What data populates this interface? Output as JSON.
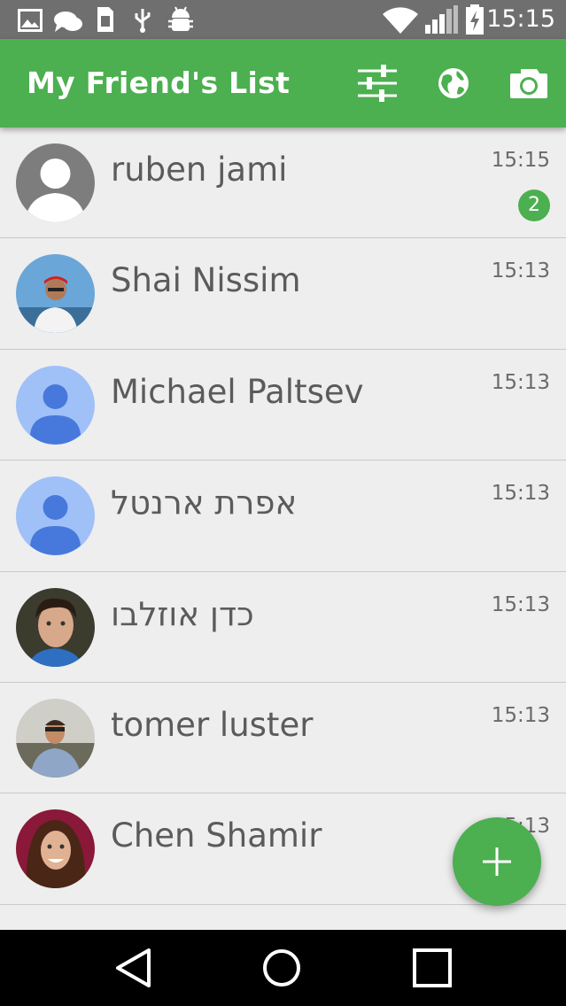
{
  "status_bar": {
    "time": "15:15",
    "icons": [
      "image-icon",
      "chat-icon",
      "sim-icon",
      "usb-icon",
      "android-debug-icon",
      "wifi-icon",
      "signal-icon",
      "battery-charging-icon"
    ]
  },
  "app_bar": {
    "title": "My Friend's List",
    "actions": [
      "sliders-icon",
      "globe-icon",
      "camera-icon"
    ],
    "color": "#4caf50"
  },
  "friends": [
    {
      "name": "ruben jami",
      "time": "15:15",
      "badge": "2",
      "avatar": "default-person"
    },
    {
      "name": "Shai Nissim",
      "time": "15:13",
      "badge": "",
      "avatar": "photo"
    },
    {
      "name": "Michael Paltsev",
      "time": "15:13",
      "badge": "",
      "avatar": "google-default"
    },
    {
      "name": "אפרת ארנטל",
      "time": "15:13",
      "badge": "",
      "avatar": "google-default"
    },
    {
      "name": "כדן אוזלבו",
      "time": "15:13",
      "badge": "",
      "avatar": "photo"
    },
    {
      "name": "tomer luster",
      "time": "15:13",
      "badge": "",
      "avatar": "photo"
    },
    {
      "name": "Chen Shamir",
      "time": "15:13",
      "badge": "",
      "avatar": "photo"
    }
  ],
  "fab": {
    "icon": "plus-icon"
  },
  "nav_bar": {
    "icons": [
      "back-icon",
      "home-icon",
      "recents-icon"
    ]
  }
}
